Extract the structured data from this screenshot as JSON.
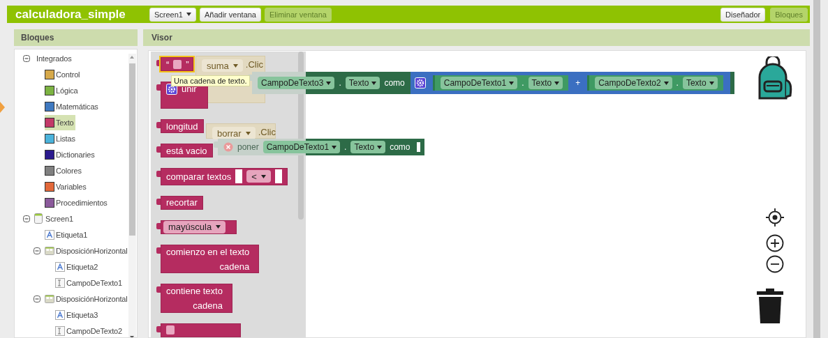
{
  "app_bar": {
    "title": "calculadora_simple",
    "buttons": [
      {
        "label": "Screen1",
        "kind": "menu",
        "disabled": false
      },
      {
        "label": "Añadir ventana",
        "kind": "button",
        "disabled": false
      },
      {
        "label": "Eliminar ventana",
        "kind": "button",
        "disabled": true
      }
    ],
    "view_switch": [
      {
        "label": "Diseñador",
        "selected": false
      },
      {
        "label": "Bloques",
        "selected": true
      }
    ]
  },
  "blocks_panel": {
    "title": "Bloques",
    "tree": [
      {
        "label": "Integrados",
        "kind": "group",
        "expanded": true,
        "selected": false,
        "children": [
          {
            "label": "Control",
            "kind": "category",
            "color": "#d6a94b",
            "selected": false
          },
          {
            "label": "Lógica",
            "kind": "category",
            "color": "#7cb342",
            "selected": false
          },
          {
            "label": "Matemáticas",
            "kind": "category",
            "color": "#3f79c0",
            "selected": false
          },
          {
            "label": "Texto",
            "kind": "category",
            "color": "#c23a68",
            "selected": true
          },
          {
            "label": "Listas",
            "kind": "category",
            "color": "#4bb3db",
            "selected": false
          },
          {
            "label": "Dictionaries",
            "kind": "category",
            "color": "#2b1a8e",
            "selected": false
          },
          {
            "label": "Colores",
            "kind": "category",
            "color": "#808080",
            "selected": false
          },
          {
            "label": "Variables",
            "kind": "category",
            "color": "#e2683a",
            "selected": false
          },
          {
            "label": "Procedimientos",
            "kind": "category",
            "color": "#8b5a9b",
            "selected": false
          }
        ]
      },
      {
        "label": "Screen1",
        "kind": "screen",
        "expanded": true,
        "selected": false,
        "children": [
          {
            "label": "Etiqueta1",
            "kind": "label",
            "selected": false
          },
          {
            "label": "DisposiciónHorizontal",
            "kind": "arrangement",
            "expanded": true,
            "selected": false,
            "children": [
              {
                "label": "Etiqueta2",
                "kind": "label",
                "selected": false
              },
              {
                "label": "CampoDeTexto1",
                "kind": "textbox",
                "selected": false
              }
            ]
          },
          {
            "label": "DisposiciónHorizontal",
            "kind": "arrangement",
            "expanded": true,
            "selected": false,
            "children": [
              {
                "label": "Etiqueta3",
                "kind": "label",
                "selected": false
              },
              {
                "label": "CampoDeTexto2",
                "kind": "textbox",
                "selected": false
              }
            ]
          }
        ]
      }
    ]
  },
  "viewer": {
    "title": "Visor",
    "flyout": [
      {
        "kind": "string",
        "open": "“",
        "close": "”",
        "selected": true
      },
      {
        "kind": "join",
        "label": "unir",
        "selected": false
      },
      {
        "kind": "plain",
        "label": "longitud",
        "selected": false
      },
      {
        "kind": "plain",
        "label": "está vacio",
        "selected": false
      },
      {
        "kind": "compare",
        "label": "comparar textos",
        "operator": "<",
        "selected": false
      },
      {
        "kind": "plain",
        "label": "recortar",
        "selected": false
      },
      {
        "kind": "dropdown",
        "label": "mayúscula",
        "selected": false
      },
      {
        "kind": "two_line",
        "lines": [
          "comienzo en el texto",
          "cadena"
        ],
        "selected": false
      },
      {
        "kind": "two_line",
        "lines": [
          "contiene  texto",
          "cadena"
        ],
        "selected": false
      },
      {
        "kind": "cut",
        "selected": false
      }
    ],
    "tooltip": "Una cadena de texto.",
    "workspace": {
      "events": [
        {
          "component": "suma",
          "event": ".Clic"
        },
        {
          "component": "borrar",
          "event": ".Clic"
        }
      ],
      "setters": [
        {
          "error": false,
          "component": "CampoDeTexto3",
          "dot": ".",
          "property": "Texto",
          "verb": "como",
          "value": {
            "kind": "join",
            "operator": "+",
            "parts": [
              {
                "component": "CampoDeTexto1",
                "dot": ".",
                "property": "Texto"
              },
              {
                "component": "CampoDeTexto2",
                "dot": ".",
                "property": "Texto"
              }
            ]
          }
        },
        {
          "error": true,
          "keyword": "poner",
          "component": "CampoDeTexto1",
          "dot": ".",
          "property": "Texto",
          "verb": "como"
        }
      ]
    }
  }
}
